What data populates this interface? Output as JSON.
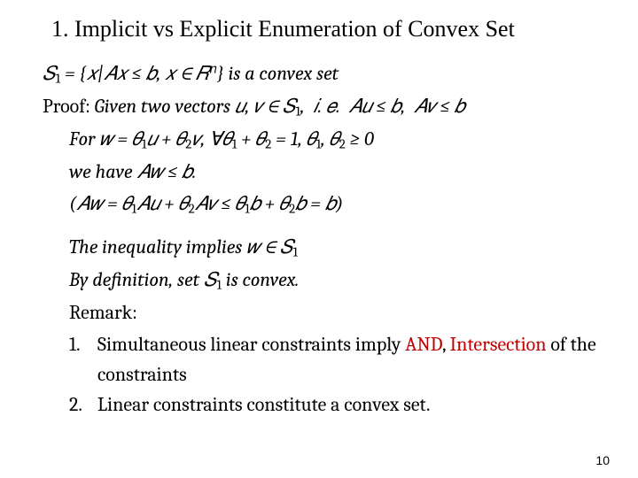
{
  "title": "1. Implicit vs Explicit Enumeration of Convex Set",
  "line_set": "𝑆<sub>1</sub> = {𝑥|𝐴𝑥 ≤ 𝑏, 𝑥 ∈ 𝑅<sup>𝑛</sup>} is a convex set",
  "proof_label": "Proof:",
  "proof_given": "Given two vectors 𝑢, 𝑣 ∈ 𝑆<sub>1</sub>,&nbsp; 𝑖. 𝑒.&nbsp; 𝐴𝑢 ≤ 𝑏,&nbsp; 𝐴𝑣 ≤ 𝑏",
  "line_for": "For 𝑤 = 𝜃<sub>1</sub>𝑢 + 𝜃<sub>2</sub>𝑣, ∀𝜃<sub>1</sub> + 𝜃<sub>2</sub> = 1, 𝜃<sub>1</sub>, 𝜃<sub>2</sub> ≥ 0",
  "line_wehave": "we have 𝐴𝑤 ≤ 𝑏.",
  "line_aw": "(𝐴𝑤 = 𝜃<sub>1</sub>𝐴𝑢 + 𝜃<sub>2</sub>𝐴𝑣 ≤ 𝜃<sub>1</sub>𝑏 + 𝜃<sub>2</sub>𝑏 = 𝑏)",
  "line_ineq": "The inequality implies 𝑤 ∈ 𝑆<sub>1</sub>",
  "line_bydef": "By definition, set 𝑆<sub>1</sub> is convex.",
  "remark_label": "Remark:",
  "remarks": [
    {
      "num": "1.",
      "text": "Simultaneous linear constraints imply <span class=\"red\">AND</span>, <span class=\"red\">Intersection</span> of the constraints"
    },
    {
      "num": "2.",
      "text": "Linear constraints constitute a convex set."
    }
  ],
  "page_number": "10"
}
